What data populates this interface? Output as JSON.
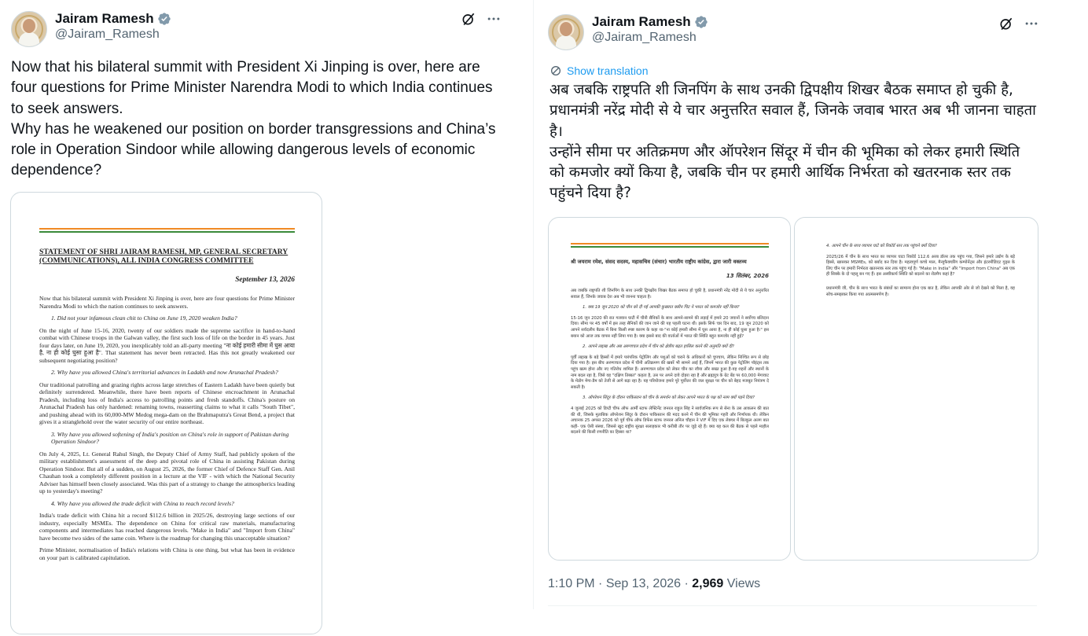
{
  "left": {
    "author": {
      "display_name": "Jairam Ramesh",
      "handle": "@Jairam_Ramesh"
    },
    "text": "Now that his bilateral summit with President Xi Jinping is over, here are four questions for Prime Minister Narendra Modi to which India continues to seek answers.\nWhy has he weakened our position on border transgressions and China’s role in Operation Sindoor while allowing dangerous levels of economic dependence?",
    "document": {
      "title": "STATEMENT OF SHRI JAIRAM RAMESH, MP, GENERAL SECRETARY (COMMUNICATIONS), ALL INDIA CONGRESS COMMITTEE",
      "date": "September 13, 2026",
      "intro": "Now that his bilateral summit with President Xi Jinping is over, here are four questions for Prime Minister Narendra Modi to which the nation continues to seek answers.",
      "q1": "1. Did not your infamous clean chit to China on June 19, 2020 weaken India?",
      "p1": "On the night of June 15-16, 2020, twenty of our soldiers made the supreme sacrifice in hand-to-hand combat with Chinese troops in the Galwan valley, the first such loss of life on the border in 45 years. Just four days later, on June 19, 2020, you inexplicably told an all-party meeting \"ना कोई हमारी सीमा में घुस आया है, ना ही कोई घुसा हुआ है\". That statement has never been retracted. Has this not greatly weakened our subsequent negotiating position?",
      "q2": "2. Why have you allowed China's territorial advances in Ladakh and now Arunachal Pradesh?",
      "p2": "Our traditional patrolling and grazing rights across large stretches of Eastern Ladakh have been quietly but definitely surrendered. Meanwhile, there have been reports of Chinese encroachment in Arunachal Pradesh, including loss of India's access to patrolling points and fresh standoffs. China's posture on Arunachal Pradesh has only hardened: renaming towns, reasserting claims to what it calls \"South Tibet\", and pushing ahead with its 60,000-MW Medog mega-dam on the Brahmaputra's Great Bend, a project that gives it a stranglehold over the water security of our entire northeast.",
      "q3": "3. Why have you allowed softening of India's position on China's role in support of Pakistan during Operation Sindoor?",
      "p3": "On July 4, 2025, Lt. General Rahul Singh, the Deputy Chief of Army Staff, had publicly spoken of the military establishment's assessment of the deep and pivotal role of China in assisting Pakistan during Operation Sindoor. But all of a sudden, on August 25, 2026, the former Chief of Defence Staff Gen. Anil Chauhan took a completely different position in a lecture at the VIF - with which the National Security Adviser has himself been closely associated. Was this part of a strategy to change the atmospherics leading up to yesterday's meeting?",
      "q4": "4. Why have you allowed the trade deficit with China to reach record levels?",
      "p4": "India's trade deficit with China hit a record $112.6 billion in 2025/26, destroying large sections of our industry, especially MSMEs. The dependence on China for critical raw materials, manufacturing components and intermediates has reached dangerous levels. \"Make in India\" and \"Import from China\" have become two sides of the same coin. Where is the roadmap for changing this unacceptable situation?",
      "closing": "Prime Minister, normalisation of India's relations with China is one thing, but what has been in evidence on your part is calibrated capitulation."
    }
  },
  "right": {
    "author": {
      "display_name": "Jairam Ramesh",
      "handle": "@Jairam_Ramesh"
    },
    "show_translation": "Show translation",
    "text": "अब जबकि राष्ट्रपति शी जिनपिंग के साथ उनकी द्विपक्षीय शिखर बैठक समाप्त हो चुकी है, प्रधानमंत्री नरेंद्र मोदी से ये चार अनुत्तरित सवाल हैं, जिनके जवाब भारत अब भी जानना चाहता है।\nउन्होंने सीमा पर अतिक्रमण और ऑपरेशन सिंदूर में चीन की भूमिका को लेकर हमारी स्थिति को कमजोर क्यों किया है, जबकि चीन पर हमारी आर्थिक निर्भरता को खतरनाक स्तर तक पहुंचने दिया है?",
    "doc1": {
      "title": "श्री जयराम रमेश, संसद सदस्य, महासचिव (संचार) भारतीय राष्ट्रीय कांग्रेस, द्वारा जारी वक्तव्य",
      "date": "13 सितंबर, 2026",
      "intro": "अब जबकि राष्ट्रपति शी जिनपिंग के साथ उनकी द्विपक्षीय शिखर बैठक समाप्त हो चुकी है, प्रधानमंत्री नरेंद्र मोदी से ये चार अनुत्तरित सवाल हैं, जिनके जवाब देश अब भी जानना चाहता है।",
      "q1": "1. क्या 19 जून 2020 को चीन को दी गई आपकी कुख्यात क्लीन चिट ने भारत को कमजोर नहीं किया?",
      "p1": "15-16 जून 2020 की रात गलवान घाटी में चीनी सैनिकों के साथ आमने-सामने की लड़ाई में हमारे 20 जवानों ने सर्वोच्च बलिदान दिया। सीमा पर 45 वर्षों में इस तरह सैनिकों की जान जाने की यह पहली घटना थी। इसके सिर्फ चार दिन बाद, 19 जून 2020 को आपने सर्वदलीय बैठक में बिना किसी स्पष्ट कारण के कहा था-\"ना कोई हमारी सीमा में घुस आया है, ना ही कोई घुसा हुआ है।\" इस बयान को आज तक वापस नहीं लिया गया है। क्या इससे बाद की वार्ताओं में भारत की स्थिति बहुत कमजोर नहीं हुई?",
      "q2": "2. आपने लद्दाख और अब अरुणाचल प्रदेश में चीन को क्षेत्रीय बढ़त हासिल करने की अनुमति क्यों दी?",
      "p2": "पूर्वी लद्दाख के बड़े हिस्सों में हमारे पारंपरिक पेट्रोलिंग और पशुओं को चराने के अधिकारों को चुपचाप, लेकिन निश्चित रूप से छोड़ दिया गया है। इस बीच अरुणाचल प्रदेश में चीनी अतिक्रमण की खबरें भी सामने आई हैं, जिनमें भारत की कुछ पेट्रोलिंग पॉइंट्स तक पहुंच खत्म होना और नए गतिरोध शामिल हैं। अरुणाचल प्रदेश को लेकर चीन का रवैया और सख्त हुआ है-वह शहरों और स्थानों के नाम बदल रहा है, जिसे वह \"दक्षिण तिब्बत\" कहता है, उस पर अपने दावे दोहरा रहा है और ब्रह्मपुत्र के ग्रेट बेंड पर 60,000 मेगावाट के मेडोग मेगा-डैम को तेजी से आगे बढ़ा रहा है। यह परियोजना हमारे पूरे पूर्वोत्तर की जल सुरक्षा पर चीन को बेहद मजबूत नियंत्रण दे सकती है।",
      "q3": "3. ऑपरेशन सिंदूर के दौरान पाकिस्तान को चीन के समर्थन को लेकर आपने भारत के पक्ष को नरम क्यों पड़ने दिया?",
      "p3": "4 जुलाई 2025 को डिप्टी चीफ ऑफ आर्मी स्टाफ लेफ्टिनेंट जनरल राहुल सिंह ने सार्वजनिक रूप से सेना के उस आकलन की बात की थी, जिसके मुताबिक ऑपरेशन सिंदूर के दौरान पाकिस्तान की मदद करने में चीन की भूमिका गहरी और निर्णायक थी। लेकिन अचानक 25 अगस्त 2026 को पूर्व चीफ ऑफ डिफेंस स्टाफ जनरल अनिल चौहान ने VIF में दिए एक लेक्चर में बिल्कुल अलग बात कही- एक ऐसी संस्था, जिससे खुद राष्ट्रीय सुरक्षा सलाहकार भी करीबी तौर पर जुड़े रहे हैं। क्या यह कल की बैठक से पहले माहौल बदलने की किसी रणनीति का हिस्सा था?"
    },
    "doc2": {
      "q4": "4. आपने चीन के साथ व्यापार घाटे को रिकॉर्ड स्तर तक पहुंचने क्यों दिया?",
      "p4": "2025/26 में चीन के साथ भारत का व्यापार घाटा रिकॉर्ड 112.6 अरब डॉलर तक पहुंच गया, जिसने हमारे उद्योग के बड़े हिस्से, खासकर MSMEs, को बर्बाद कर दिया है। महत्वपूर्ण कच्चे माल, मैन्युफैक्चरिंग कम्पोनेंट्स और इंटरमीडिएट गुड्स के लिए चीन पर हमारी निर्भरता खतरनाक स्तर तक पहुंच गई है। \"Make in India\" और \"Import from China\" अब एक ही सिक्के के दो पहलू बन गए हैं। इस अस्वीकार्य स्थिति को बदलने का रोडमैप कहां है?",
      "closing": "प्रधानमंत्री जी, चीन के साथ भारत के संबंधों का सामान्य होना एक बात है, लेकिन आपकी ओर से जो देखने को मिला है, वह सोच-समझकर किया गया आत्मसमर्पण है।"
    },
    "meta": {
      "time": "1:10 PM",
      "sep": "·",
      "date": "Sep 13, 2026",
      "views_count": "2,969",
      "views_label": "Views"
    }
  },
  "colors": {
    "link": "#1d9bf0",
    "muted": "#536471",
    "verified_badge": "#829aab",
    "saffron": "#f08a24",
    "green": "#3a8a3a"
  },
  "icons": [
    "grok-icon",
    "more-options-icon",
    "verified-badge-icon",
    "translate-icon"
  ]
}
